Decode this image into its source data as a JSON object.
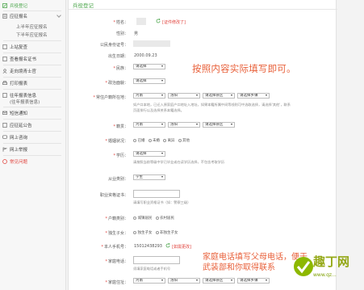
{
  "sidebar": {
    "items": [
      {
        "label": "兵役登记",
        "active": true
      },
      {
        "label": "应征报名"
      },
      {
        "label": "上半年应征报名",
        "sub": true
      },
      {
        "label": "下半年应征报名",
        "sub": true
      },
      {
        "label": "上站复查"
      },
      {
        "label": "查看报名证书"
      },
      {
        "label": "走向境青士官"
      },
      {
        "label": "打印报表"
      },
      {
        "label": "往年报表信息",
        "sub_text": "(往年报表信息)"
      },
      {
        "label": "短信通知"
      },
      {
        "label": "应征延公告"
      },
      {
        "label": "网上咨询"
      },
      {
        "label": "网上举报"
      },
      {
        "label": "常见问题",
        "red": true
      }
    ]
  },
  "main": {
    "title": "兵役登记",
    "fields": {
      "name_label": "姓名：",
      "name_link": "[证件修改了]",
      "gender_label": "性别：",
      "gender_value": "男",
      "id_label": "公民身份证号：",
      "birth_label": "出生日期：",
      "birth_value": "2000.09.23",
      "ethnic_label": "民族：",
      "ethnic_value": "请选择",
      "politics_label": "政治面貌：",
      "politics_value": "请选择",
      "residence_label": "常住户籍所在地：",
      "residence_sel1": "河南",
      "residence_sel2": "洛阳",
      "residence_sel3": "请选择县区",
      "residence_sel4": "请选择乡镇",
      "residence_hint1": "如户口本地，已迁入原家庭户口地址入地址，如果本籍所属中间等线则可中选取选择，请选择'其他'，联系",
      "residence_hint2": "页面排行以及选择关系本籍选择。",
      "native_label": "籍贯：",
      "native_sel1": "河南",
      "native_sel2": "洛阳",
      "native_sel3": "请选择县区",
      "marital_label": "婚姻状况：",
      "marital_options": [
        "已婚",
        "未婚",
        "离异",
        "其他"
      ],
      "education_label": "学历：",
      "education_value": "请选择",
      "education_hint": "请按照当前等级中学已毕业或在读学历选择，不包含考取学历",
      "occupation_label": "从业类别：",
      "occupation_value": "学生",
      "cert_label": "职业资格证书：",
      "cert_hint": "请填写职业资格证书（如：警察三级）",
      "hukou_label": "户籍类别：",
      "hukou_options": [
        "城镇居民",
        "农村居民"
      ],
      "only_child_label": "独生子女：",
      "only_child_options": [
        "独生子女",
        "非独生子女"
      ],
      "phone_label": "本人手机号：",
      "phone_value": "15012438293",
      "phone_link": "[如需更改]",
      "home_phone_label": "家庭电话：",
      "home_phone_hint": "须填家庭电话或者手机号",
      "address_label": "家庭住址：",
      "address_sel1": "河南",
      "address_sel2": "洛阳",
      "address_sel3": "请选择县区",
      "address_sel4": "请选择乡镇"
    }
  },
  "annotations": {
    "main_note": "按照内容实际填写即可。",
    "phone_note_line1": "家庭电话填写父母电话，便于",
    "phone_note_line2": "武装部和你取得联系"
  },
  "watermark": {
    "brand": "趣丁网",
    "url": "www.qz..."
  },
  "colors": {
    "accent": "#4ca64c",
    "annotation": "#e8603a",
    "required": "#e0403a"
  }
}
